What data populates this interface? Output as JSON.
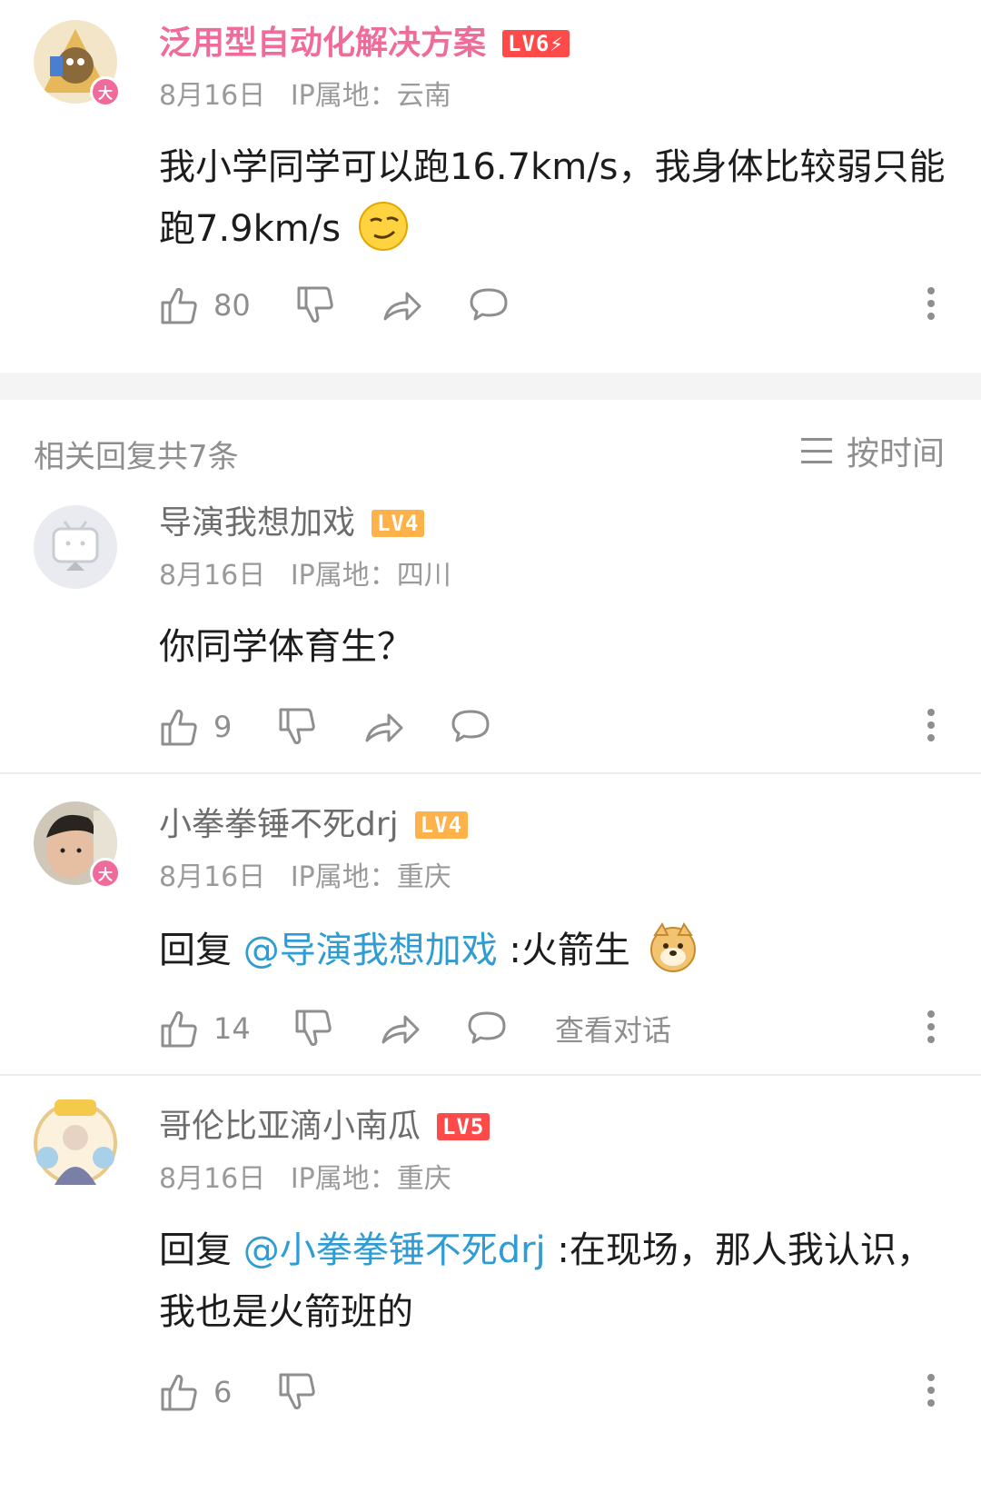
{
  "comments": [
    {
      "username": "泛用型自动化解决方案",
      "level": "LV6⚡",
      "date": "8月16日",
      "ip": "IP属地：云南",
      "text": "我小学同学可以跑16.7km/s，我身体比较弱只能跑7.9km/s",
      "emoji": "smirk-emoji",
      "likes": "80"
    },
    {
      "username": "导演我想加戏",
      "level": "LV4",
      "date": "8月16日",
      "ip": "IP属地：四川",
      "text": "你同学体育生？",
      "likes": "9"
    },
    {
      "username": "小拳拳锤不死drj",
      "level": "LV4",
      "date": "8月16日",
      "ip": "IP属地：重庆",
      "reply_prefix": "回复",
      "mention": "@导演我想加戏",
      "text": " :火箭生",
      "emoji": "doge-emoji",
      "likes": "14",
      "view_conversation": "查看对话"
    },
    {
      "username": "哥伦比亚滴小南瓜",
      "level": "LV5",
      "date": "8月16日",
      "ip": "IP属地：重庆",
      "reply_prefix": "回复",
      "mention": "@小拳拳锤不死drj",
      "text": " :在现场，那人我认识，我也是火箭班的",
      "likes": "6"
    }
  ],
  "replies_header": {
    "count_label": "相关回复共7条",
    "sort_label": "按时间"
  },
  "colors": {
    "vip_name": "#f06b9a",
    "mention": "#2f9cd4",
    "level_red": "#ff4a4a",
    "level_orange": "#ffb14a"
  }
}
